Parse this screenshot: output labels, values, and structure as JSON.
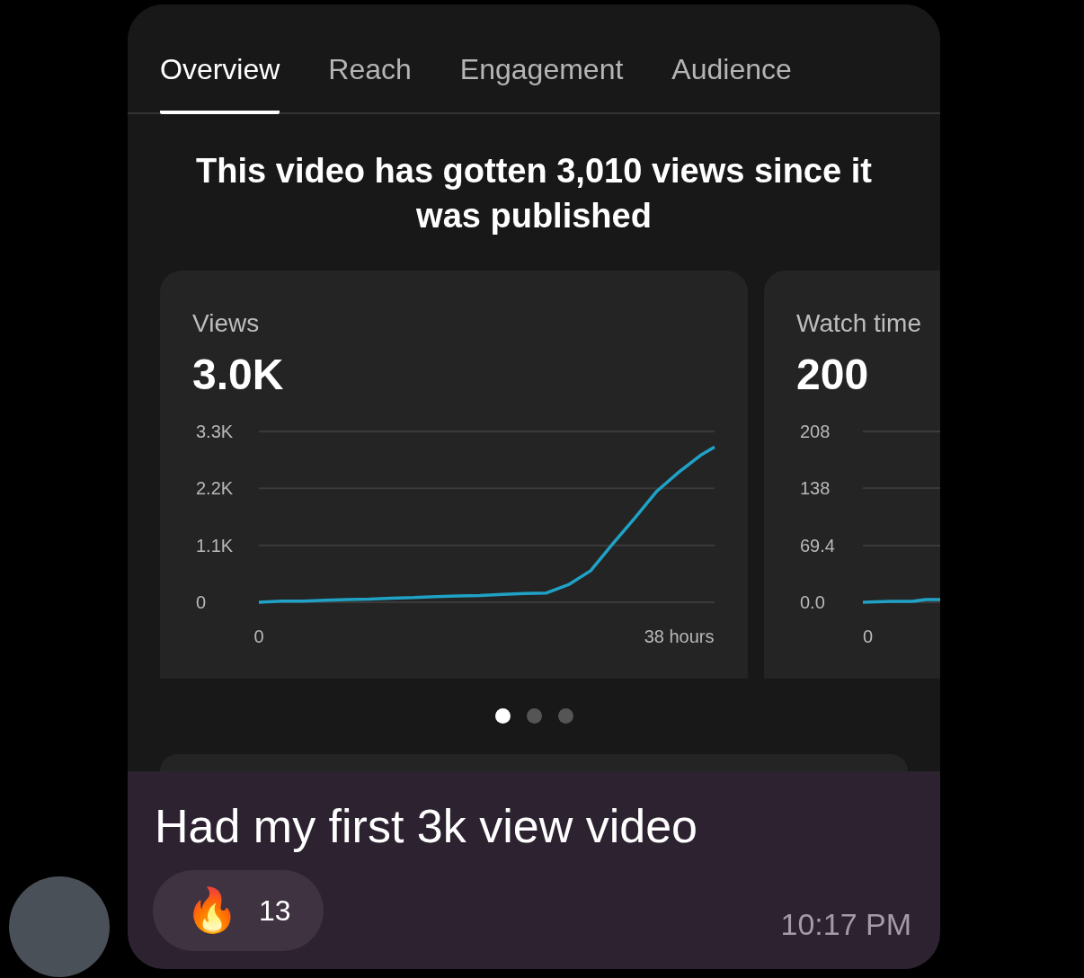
{
  "tabs": [
    {
      "label": "Overview",
      "selected": true
    },
    {
      "label": "Reach",
      "selected": false
    },
    {
      "label": "Engagement",
      "selected": false
    },
    {
      "label": "Audience",
      "selected": false
    }
  ],
  "headline": "This video has gotten 3,010 views since it was published",
  "cards": [
    {
      "label": "Views",
      "value": "3.0K",
      "chart_data": {
        "type": "line",
        "x": [
          0,
          2,
          4,
          6,
          8,
          10,
          12,
          14,
          16,
          18,
          20,
          22,
          24,
          26,
          28,
          30,
          32,
          34,
          36,
          38,
          40,
          41.2
        ],
        "xlim": [
          0,
          41.2
        ],
        "ylim": [
          0,
          3300
        ],
        "yticks": [
          {
            "value": 0,
            "label": "0"
          },
          {
            "value": 1100,
            "label": "1.1K"
          },
          {
            "value": 2200,
            "label": "2.2K"
          },
          {
            "value": 3300,
            "label": "3.3K"
          }
        ],
        "xticks": [
          {
            "value": 0,
            "label": "0"
          },
          {
            "value": 38,
            "label": "38 hours"
          }
        ],
        "series": [
          {
            "color": "#1fa2c6",
            "values": [
              0,
              20,
              20,
              40,
              50,
              60,
              80,
              90,
              110,
              120,
              130,
              150,
              170,
              180,
              340,
              610,
              1130,
              1630,
              2150,
              2520,
              2850,
              3000
            ]
          }
        ]
      }
    },
    {
      "label": "Watch time",
      "value": "200",
      "y_labels": [
        "208",
        "138",
        "69.4",
        "0.0"
      ],
      "x_label": "0"
    }
  ],
  "page_dots": [
    {
      "selected": true
    },
    {
      "selected": false
    },
    {
      "selected": false
    }
  ],
  "message": {
    "text": "Had my first 3k view video",
    "reaction": {
      "emoji": "🔥",
      "count": "13"
    },
    "time": "10:17 PM"
  }
}
